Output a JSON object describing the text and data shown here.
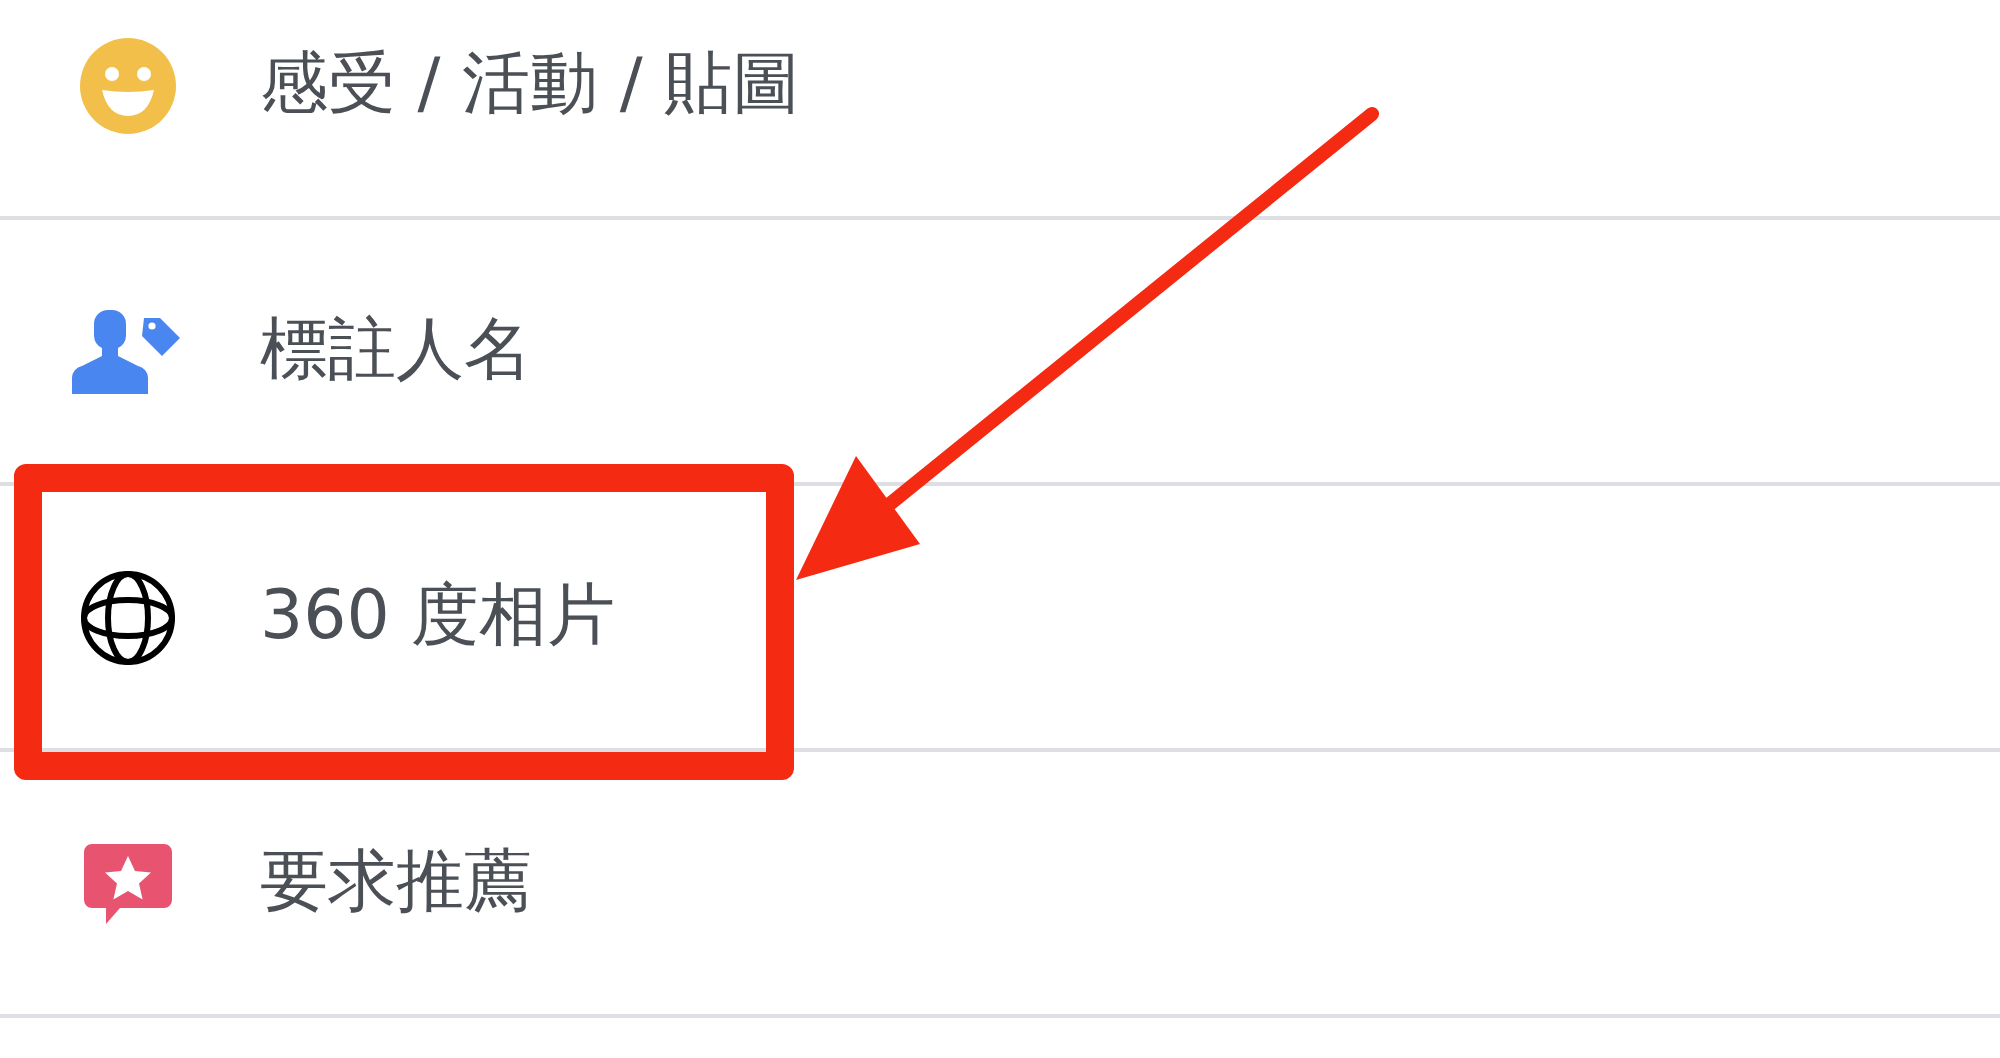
{
  "menu_items": [
    {
      "kind": "feeling",
      "label": "感受 / 活動 / 貼圖",
      "highlighted": false
    },
    {
      "kind": "tag",
      "label": "標註人名",
      "highlighted": false
    },
    {
      "kind": "photo360",
      "label": "360 度相片",
      "highlighted": true
    },
    {
      "kind": "recommend",
      "label": "要求推薦",
      "highlighted": false
    }
  ]
}
